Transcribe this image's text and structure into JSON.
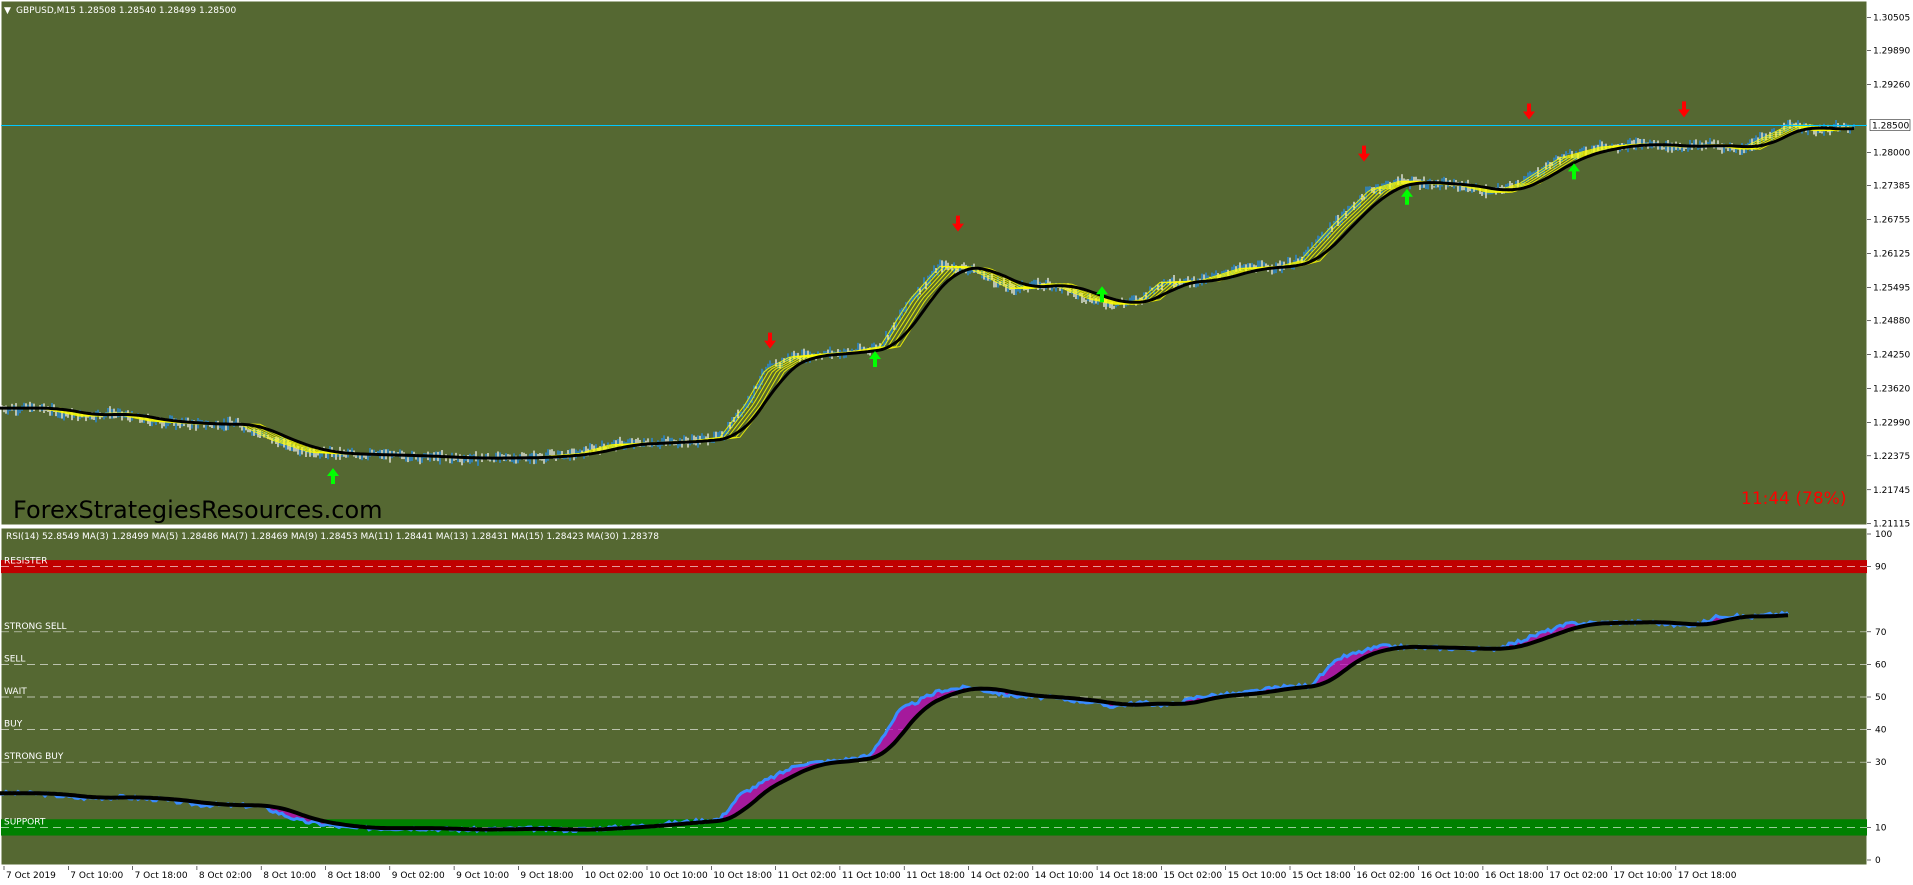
{
  "colors": {
    "background": "#556832",
    "bull_candle": "#1e90ff",
    "ribbon": "#ffff00",
    "ma_slow": "#000000",
    "bid_line": "#00c8ff",
    "buy_arrow": "#00ff00",
    "sell_arrow": "#ff0000",
    "rsi_fast": "#3a8cff",
    "rsi_fill": "#c000c0",
    "resister_band": "#c00000",
    "support_band": "#008000",
    "timer": "#ff0000"
  },
  "main_panel": {
    "header": "GBPUSD,M15  1.28508 1.28540 1.28499 1.28500",
    "watermark": "ForexStrategiesResources.com",
    "timer": "11:44 (78%)",
    "price_label": "1.28500",
    "price_axis_labels": [
      "1.30505",
      "1.29890",
      "1.29260",
      "1.28500",
      "1.28000",
      "1.27385",
      "1.26755",
      "1.26125",
      "1.25495",
      "1.24880",
      "1.24250",
      "1.23620",
      "1.22990",
      "1.22375",
      "1.21745",
      "1.21115"
    ]
  },
  "sub_panel": {
    "header": "RSI(14) 52.8549  MA(3) 1.28499  MA(5) 1.28486  MA(7) 1.28469  MA(9) 1.28453  MA(11) 1.28441  MA(13) 1.28431  MA(15) 1.28423  MA(30) 1.28378",
    "zone_labels": [
      "RESISTER",
      "STRONG SELL",
      "SELL",
      "WAIT",
      "BUY",
      "STRONG BUY",
      "SUPPORT"
    ],
    "axis_labels": [
      "100",
      "90",
      "70",
      "60",
      "50",
      "40",
      "30",
      "10",
      "0"
    ]
  },
  "time_axis_labels": [
    "7 Oct 2019",
    "7 Oct 10:00",
    "7 Oct 18:00",
    "8 Oct 02:00",
    "8 Oct 10:00",
    "8 Oct 18:00",
    "9 Oct 02:00",
    "9 Oct 10:00",
    "9 Oct 18:00",
    "10 Oct 02:00",
    "10 Oct 10:00",
    "10 Oct 18:00",
    "11 Oct 02:00",
    "11 Oct 10:00",
    "11 Oct 18:00",
    "14 Oct 02:00",
    "14 Oct 10:00",
    "14 Oct 18:00",
    "15 Oct 02:00",
    "15 Oct 10:00",
    "15 Oct 18:00",
    "16 Oct 02:00",
    "16 Oct 10:00",
    "16 Oct 18:00",
    "17 Oct 02:00",
    "17 Oct 10:00",
    "17 Oct 18:00"
  ],
  "chart_data": [
    {
      "type": "line",
      "symbol": "GBPUSD",
      "timeframe": "M15",
      "ylim": [
        1.2111,
        1.3068
      ],
      "current_price": 1.285,
      "series": [
        {
          "values": [
            [
              0,
              1.2326
            ],
            [
              40,
              1.2326
            ],
            [
              80,
              1.2311
            ],
            [
              110,
              1.2317
            ],
            [
              150,
              1.2302
            ],
            [
              200,
              1.2296
            ],
            [
              240,
              1.2296
            ],
            [
              270,
              1.2268
            ],
            [
              310,
              1.2244
            ],
            [
              350,
              1.224
            ],
            [
              400,
              1.2238
            ],
            [
              460,
              1.2233
            ],
            [
              530,
              1.2234
            ],
            [
              580,
              1.2242
            ],
            [
              610,
              1.2258
            ],
            [
              690,
              1.2265
            ],
            [
              720,
              1.2272
            ],
            [
              745,
              1.2332
            ],
            [
              765,
              1.2396
            ],
            [
              790,
              1.2421
            ],
            [
              820,
              1.2426
            ],
            [
              850,
              1.243
            ],
            [
              880,
              1.244
            ],
            [
              910,
              1.2528
            ],
            [
              940,
              1.2589
            ],
            [
              970,
              1.2585
            ],
            [
              1010,
              1.2547
            ],
            [
              1050,
              1.2557
            ],
            [
              1090,
              1.2528
            ],
            [
              1115,
              1.2518
            ],
            [
              1140,
              1.2527
            ],
            [
              1160,
              1.2559
            ],
            [
              1200,
              1.2562
            ],
            [
              1240,
              1.2585
            ],
            [
              1280,
              1.2589
            ],
            [
              1300,
              1.2599
            ],
            [
              1330,
              1.266
            ],
            [
              1370,
              1.2731
            ],
            [
              1400,
              1.2747
            ],
            [
              1430,
              1.2742
            ],
            [
              1460,
              1.2739
            ],
            [
              1490,
              1.2725
            ],
            [
              1520,
              1.2743
            ],
            [
              1560,
              1.279
            ],
            [
              1600,
              1.281
            ],
            [
              1640,
              1.2816
            ],
            [
              1680,
              1.281
            ],
            [
              1710,
              1.2815
            ],
            [
              1740,
              1.2806
            ],
            [
              1765,
              1.2829
            ],
            [
              1790,
              1.2852
            ],
            [
              1815,
              1.284
            ],
            [
              1835,
              1.2846
            ],
            [
              1855,
              1.2847
            ]
          ]
        }
      ],
      "signals": {
        "buy": [
          [
            333,
            1.22
          ],
          [
            875,
            1.2417
          ],
          [
            1102,
            1.2537
          ],
          [
            1407,
            1.2718
          ],
          [
            1574,
            1.2765
          ]
        ],
        "sell": [
          [
            770,
            1.2451
          ],
          [
            958,
            1.2668
          ],
          [
            1364,
            1.2798
          ],
          [
            1529,
            1.2876
          ],
          [
            1684,
            1.288
          ]
        ]
      }
    },
    {
      "type": "line",
      "title": "RSI(14)",
      "ylim": [
        0,
        100
      ],
      "levels": [
        10,
        30,
        40,
        50,
        60,
        70,
        90
      ],
      "series": [
        {
          "values": [
            [
              0,
              20.5
            ],
            [
              40,
              20.4
            ],
            [
              80,
              19.0
            ],
            [
              120,
              19.3
            ],
            [
              160,
              18.6
            ],
            [
              200,
              17.0
            ],
            [
              260,
              16.6
            ],
            [
              300,
              12.0
            ],
            [
              350,
              9.8
            ],
            [
              420,
              9.8
            ],
            [
              460,
              9.3
            ],
            [
              530,
              9.6
            ],
            [
              570,
              9.2
            ],
            [
              630,
              10.2
            ],
            [
              680,
              11.5
            ],
            [
              720,
              12.5
            ],
            [
              740,
              20.0
            ],
            [
              770,
              25.0
            ],
            [
              800,
              29.5
            ],
            [
              840,
              30.5
            ],
            [
              870,
              32.0
            ],
            [
              900,
              46.0
            ],
            [
              940,
              52.0
            ],
            [
              970,
              53.0
            ],
            [
              1010,
              50.5
            ],
            [
              1050,
              49.8
            ],
            [
              1090,
              48.5
            ],
            [
              1110,
              47.2
            ],
            [
              1140,
              48.2
            ],
            [
              1170,
              47.5
            ],
            [
              1200,
              50.2
            ],
            [
              1240,
              51.0
            ],
            [
              1280,
              53.0
            ],
            [
              1310,
              53.5
            ],
            [
              1340,
              62.0
            ],
            [
              1380,
              65.5
            ],
            [
              1420,
              65.2
            ],
            [
              1450,
              65.0
            ],
            [
              1490,
              64.6
            ],
            [
              1510,
              66.0
            ],
            [
              1540,
              69.5
            ],
            [
              1570,
              72.5
            ],
            [
              1610,
              72.8
            ],
            [
              1650,
              73.0
            ],
            [
              1680,
              72.0
            ],
            [
              1700,
              72.4
            ],
            [
              1720,
              75.0
            ],
            [
              1750,
              74.5
            ],
            [
              1770,
              75.2
            ],
            [
              1790,
              75.5
            ]
          ]
        }
      ]
    }
  ]
}
